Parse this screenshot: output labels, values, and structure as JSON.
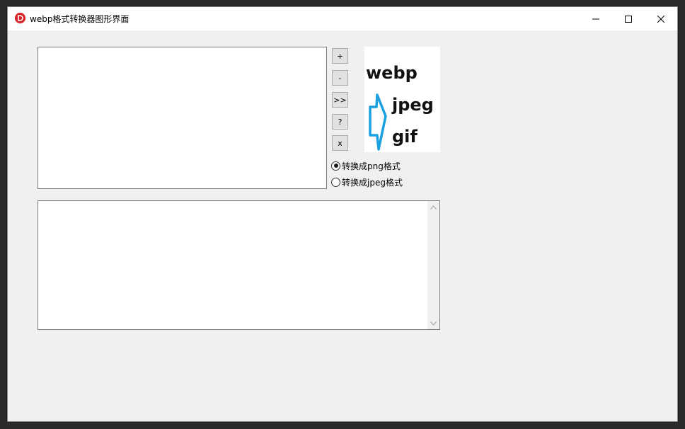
{
  "window": {
    "title": "webp格式转换器图形界面",
    "app_icon": "red-circle-d-icon",
    "controls": {
      "minimize": "minimize-icon",
      "maximize": "maximize-icon",
      "close": "close-icon"
    }
  },
  "file_list": {
    "items": []
  },
  "buttons": {
    "add": "+",
    "remove": "-",
    "convert": ">>",
    "help": "?",
    "clear": "x"
  },
  "logo": {
    "line1": "webp",
    "line2": "jpeg",
    "line3": "gif",
    "text_color": "#111111",
    "arrow_color": "#1aa0e0"
  },
  "options": {
    "png_label": "转换成png格式",
    "jpeg_label": "转换成jpeg格式",
    "selected": "png"
  },
  "output": {
    "text": ""
  },
  "colors": {
    "window_bg": "#f0f0f0",
    "titlebar_bg": "#ffffff",
    "icon_red": "#d9262c",
    "button_bg": "#e1e1e1"
  }
}
